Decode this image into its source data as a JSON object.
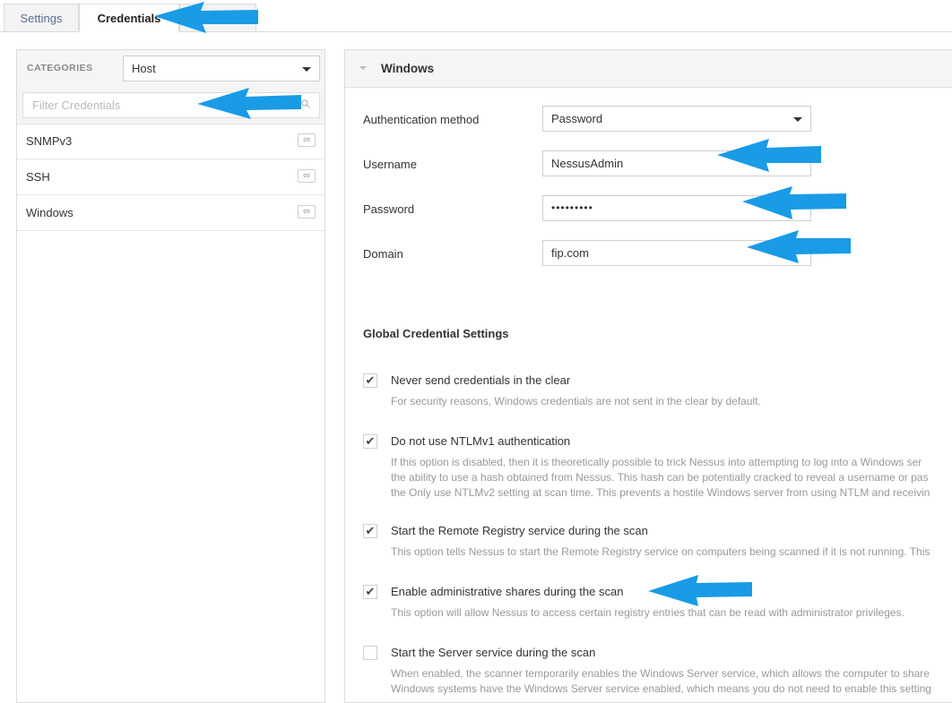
{
  "tabs": {
    "settings": "Settings",
    "credentials": "Credentials"
  },
  "left_panel": {
    "categories_label": "CATEGORIES",
    "category_selected": "Host",
    "filter_placeholder": "Filter Credentials",
    "items": [
      {
        "label": "SNMPv3"
      },
      {
        "label": "SSH"
      },
      {
        "label": "Windows"
      }
    ]
  },
  "right_panel": {
    "title": "Windows",
    "auth_method_label": "Authentication method",
    "auth_method_value": "Password",
    "username_label": "Username",
    "username_value": "NessusAdmin",
    "password_label": "Password",
    "password_value": "•••••••••",
    "domain_label": "Domain",
    "domain_value": "fip.com",
    "global_title": "Global Credential Settings",
    "options": [
      {
        "title": "Never send credentials in the clear",
        "checked": true,
        "desc": [
          "For security reasons, Windows credentials are not sent in the clear by default."
        ]
      },
      {
        "title": "Do not use NTLMv1 authentication",
        "checked": true,
        "desc": [
          "If this option is disabled, then it is theoretically possible to trick Nessus into attempting to log into a Windows ser",
          "the ability to use a hash obtained from Nessus. This hash can be potentially cracked to reveal a username or pas",
          "the Only use NTLMv2 setting at scan time. This prevents a hostile Windows server from using NTLM and receivin"
        ]
      },
      {
        "title": "Start the Remote Registry service during the scan",
        "checked": true,
        "desc": [
          "This option tells Nessus to start the Remote Registry service on computers being scanned if it is not running. This"
        ]
      },
      {
        "title": "Enable administrative shares during the scan",
        "checked": true,
        "desc": [
          "This option will allow Nessus to access certain registry entries that can be read with administrator privileges."
        ]
      },
      {
        "title": "Start the Server service during the scan",
        "checked": false,
        "desc": [
          "When enabled, the scanner temporarily enables the Windows Server service, which allows the computer to share",
          "Windows systems have the Windows Server service enabled, which means you do not need to enable this setting"
        ]
      }
    ],
    "check_glyph": "✔"
  },
  "icons": {
    "search": "search-icon",
    "infinity": "∞"
  },
  "colors": {
    "arrow": "#1a9be6",
    "tab_link": "#5a6f95"
  }
}
